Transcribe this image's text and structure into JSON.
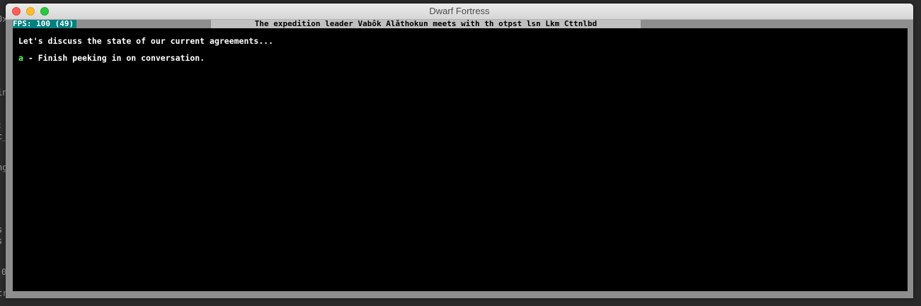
{
  "background_terminal": {
    "fragments": [
      "0x",
      "in",
      ":",
      "c_",
      "ng",
      "s",
      "s",
      "0",
      "cri"
    ]
  },
  "window": {
    "title": "Dwarf Fortress"
  },
  "hud": {
    "fps": "FPS: 100 (49)",
    "header": "The expedition leader Vabôk Alåthokun meets with th otpst lsn Lkm Cttnlbd"
  },
  "dialog": {
    "prompt": "Let's discuss the state of our current agreements...",
    "options": [
      {
        "key": "a",
        "separator": " - ",
        "label": "Finish peeking in on conversation."
      }
    ]
  },
  "colors": {
    "fps_bg": "#008080",
    "header_bg": "#c0c0c0",
    "hotkey": "#55ff55",
    "screen_bg": "#000000",
    "frame": "#8e8e8e"
  }
}
